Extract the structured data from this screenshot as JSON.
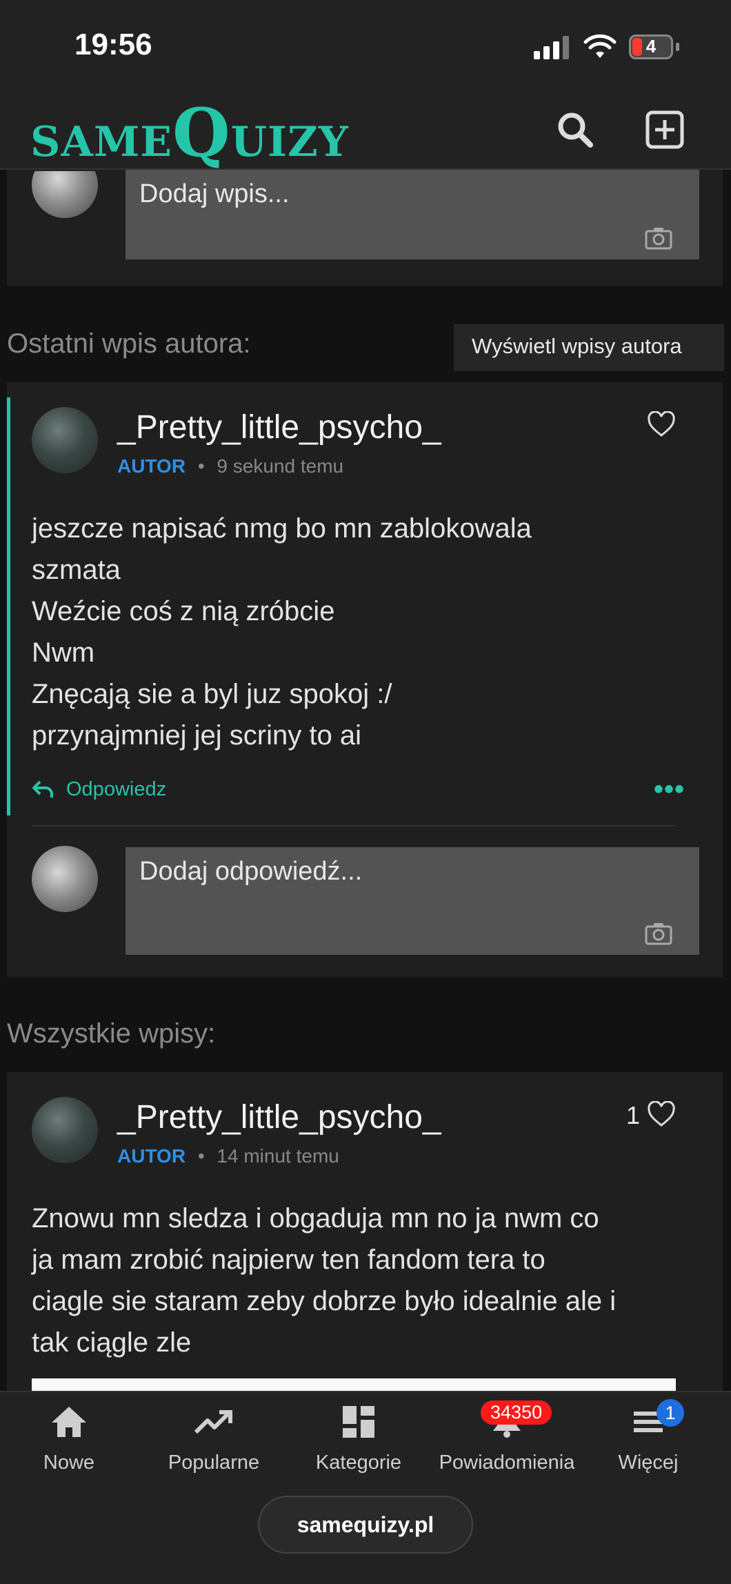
{
  "status_bar": {
    "time": "19:56",
    "battery": "4"
  },
  "header": {
    "logo_small": "SAME",
    "logo_big": "Q",
    "logo_rest": "UIZY"
  },
  "composer": {
    "placeholder": "Dodaj wpis..."
  },
  "latest_section": {
    "label": "Ostatni wpis autora:",
    "button": "Wyświetl wpisy autora"
  },
  "latest_post": {
    "username": "_Pretty_little_psycho_",
    "badge": "AUTOR",
    "dot": "•",
    "time": "9 sekund temu",
    "text": "jeszcze napisać nmg bo mn zablokowala\nszmata\nWeźcie coś z nią zróbcie\nNwm\nZnęcają sie a byl juz spokoj :/\nprzynajmniej jej scriny to ai",
    "reply_label": "Odpowiedz",
    "more": "•••",
    "reply_placeholder": "Dodaj odpowiedź..."
  },
  "all_section": {
    "label": "Wszystkie wpisy:"
  },
  "post2": {
    "username": "_Pretty_little_psycho_",
    "badge": "AUTOR",
    "dot": "•",
    "time": "14 minut temu",
    "likes": "1",
    "text": "Znowu mn sledza i obgaduja mn no ja nwm co\nja mam zrobić najpierw ten fandom tera to\nciagle sie staram zeby dobrze było idealnie ale i\ntak ciągle zle"
  },
  "nav": {
    "items": [
      {
        "label": "Nowe",
        "icon": "home-icon"
      },
      {
        "label": "Popularne",
        "icon": "trending-icon"
      },
      {
        "label": "Kategorie",
        "icon": "grid-icon"
      },
      {
        "label": "Powiadomienia",
        "icon": "bell-icon",
        "badge": "34350"
      },
      {
        "label": "Więcej",
        "icon": "menu-icon",
        "badge": "1"
      }
    ]
  },
  "url": "samequizy.pl"
}
